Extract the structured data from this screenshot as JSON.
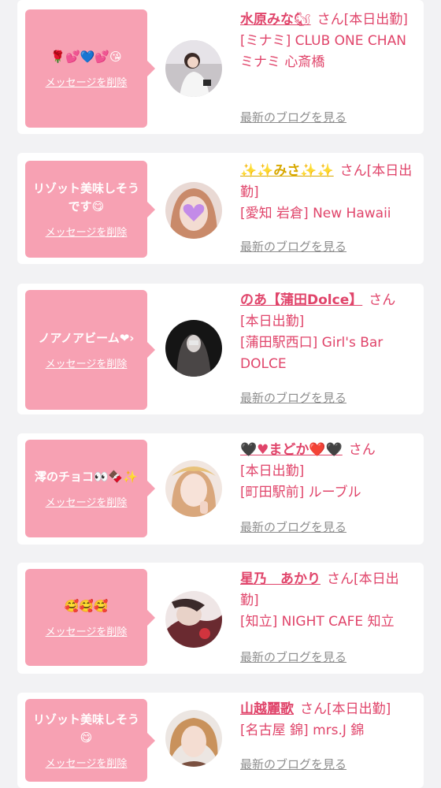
{
  "delete_label": "メッセージを削除",
  "blog_label": "最新のブログを見る",
  "colors": {
    "accent": "#e0446a",
    "bubble": "#f7a1b3",
    "background": "#f2f2f4",
    "link_gray": "#8d8d8d"
  },
  "cards": [
    {
      "message": "🌹💕💙💕😘",
      "name": "水原みな",
      "name_emoji": "🐿",
      "suffix": "さん",
      "status": "[本日出勤]",
      "shop": "[ミナミ] CLUB ONE CHAN ミナミ 心斎橋",
      "avatar_icon": "profile-photo-icon"
    },
    {
      "message": "リゾット美味しそうです😋",
      "name": "✨✨みさ✨✨",
      "name_emoji": "",
      "suffix": "さん",
      "status": "[本日出勤]",
      "shop": "[愛知 岩倉] New Hawaii",
      "avatar_icon": "profile-photo-icon"
    },
    {
      "message": "ノアノアビーム❤︎›",
      "name": "のあ【蒲田Dolce】",
      "name_emoji": "",
      "suffix": "さん",
      "status": "[本日出勤]",
      "shop": "[蒲田駅西口] Girl's Bar DOLCE",
      "avatar_icon": "profile-photo-icon"
    },
    {
      "message": "澪のチョコ👀🍫✨",
      "name": "🖤♥まどか❤️🖤",
      "name_emoji": "",
      "suffix": "さん",
      "status": "[本日出勤]",
      "shop": "[町田駅前] ルーブル",
      "avatar_icon": "profile-photo-icon"
    },
    {
      "message": "🥰🥰🥰",
      "name": "星乃　あかり",
      "name_emoji": "",
      "suffix": "さん",
      "status": "[本日出勤]",
      "shop": "[知立] NIGHT CAFE 知立",
      "avatar_icon": "profile-photo-icon"
    },
    {
      "message": "リゾット美味しそう😋",
      "name": "山越麗歌",
      "name_emoji": "",
      "suffix": "さん",
      "status": "[本日出勤]",
      "shop": "[名古屋 錦] mrs.J 錦",
      "avatar_icon": "profile-photo-icon"
    }
  ]
}
